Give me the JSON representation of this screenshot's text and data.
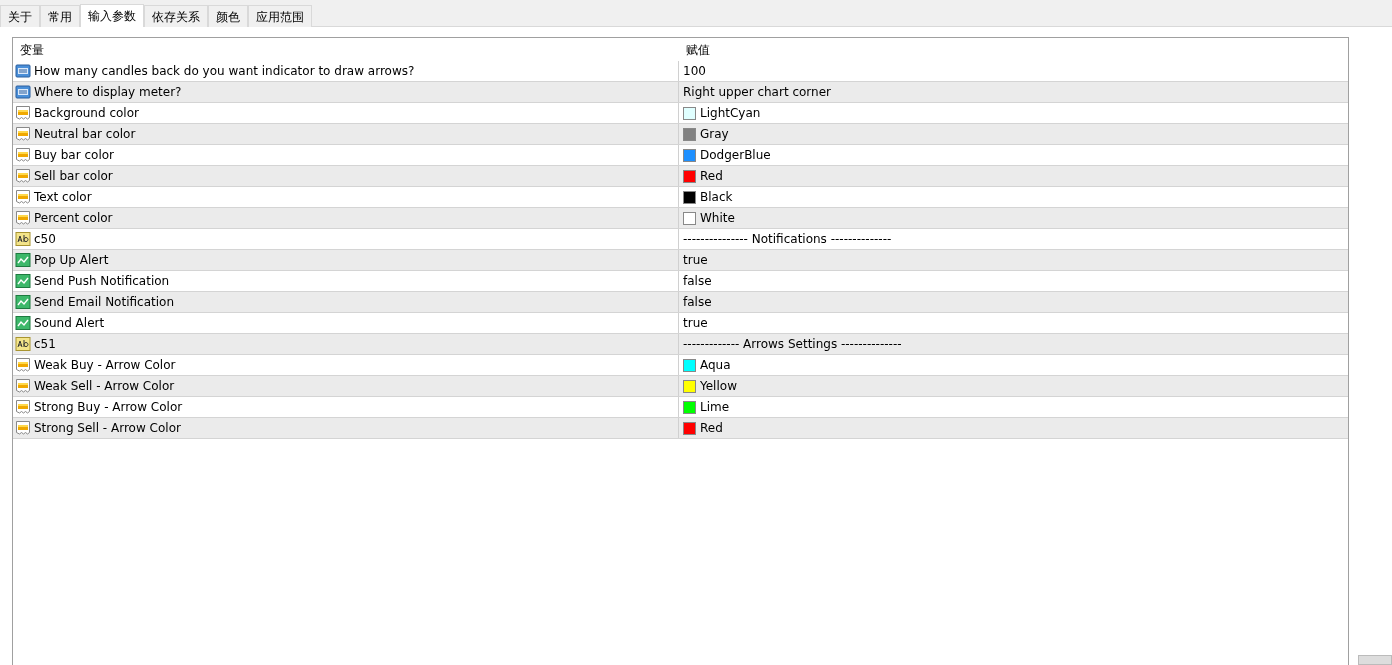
{
  "tabs": [
    {
      "label": "关于",
      "selected": false
    },
    {
      "label": "常用",
      "selected": false
    },
    {
      "label": "输入参数",
      "selected": true
    },
    {
      "label": "依存关系",
      "selected": false
    },
    {
      "label": "颜色",
      "selected": false
    },
    {
      "label": "应用范围",
      "selected": false
    }
  ],
  "table": {
    "columns": [
      "变量",
      "赋值"
    ],
    "rows": [
      {
        "kind": "number",
        "name": "How many candles back do you want indicator to draw arrows?",
        "value": "100"
      },
      {
        "kind": "number",
        "name": "Where to display meter?",
        "value": "Right upper chart corner"
      },
      {
        "kind": "color",
        "name": "Background color",
        "value": "LightCyan",
        "color": "#e0ffff"
      },
      {
        "kind": "color",
        "name": "Neutral bar color",
        "value": "Gray",
        "color": "#808080"
      },
      {
        "kind": "color",
        "name": "Buy bar color",
        "value": "DodgerBlue",
        "color": "#1e90ff"
      },
      {
        "kind": "color",
        "name": "Sell bar color",
        "value": "Red",
        "color": "#ff0000"
      },
      {
        "kind": "color",
        "name": "Text color",
        "value": "Black",
        "color": "#000000"
      },
      {
        "kind": "color",
        "name": "Percent color",
        "value": "White",
        "color": "#ffffff"
      },
      {
        "kind": "string",
        "name": "c50",
        "value": "--------------- Notifications --------------"
      },
      {
        "kind": "bool",
        "name": "Pop Up Alert",
        "value": "true"
      },
      {
        "kind": "bool",
        "name": "Send Push Notification",
        "value": "false"
      },
      {
        "kind": "bool",
        "name": "Send Email Notification",
        "value": "false"
      },
      {
        "kind": "bool",
        "name": "Sound Alert",
        "value": "true"
      },
      {
        "kind": "string",
        "name": "c51",
        "value": "------------- Arrows Settings --------------"
      },
      {
        "kind": "color",
        "name": "Weak Buy - Arrow Color",
        "value": "Aqua",
        "color": "#00ffff"
      },
      {
        "kind": "color",
        "name": "Weak Sell - Arrow Color",
        "value": "Yellow",
        "color": "#ffff00"
      },
      {
        "kind": "color",
        "name": "Strong Buy - Arrow Color",
        "value": "Lime",
        "color": "#00ff00"
      },
      {
        "kind": "color",
        "name": "Strong Sell - Arrow Color",
        "value": "Red",
        "color": "#ff0000"
      }
    ]
  }
}
